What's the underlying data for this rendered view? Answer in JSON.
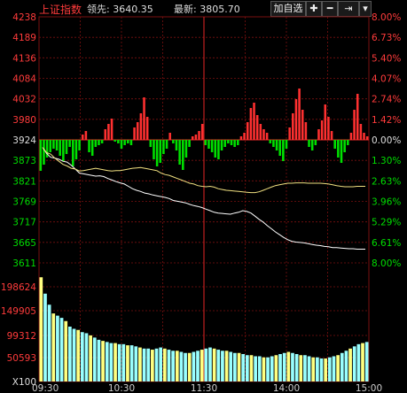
{
  "header": {
    "index_name": "上证指数",
    "lead_label": "领先:",
    "lead_value": "3640.35",
    "last_label": "最新:",
    "last_value": "3805.70",
    "add_button": "加自选",
    "plus_icon": "plus-icon",
    "minus_icon": "minus-icon",
    "skip_icon": "skip-end-icon",
    "dropdown_icon": "triangle-down-icon"
  },
  "colors": {
    "background": "#000000",
    "grid": "#7a1010",
    "up": "#ff3030",
    "down": "#00e000",
    "price_line": "#ffffff",
    "lead_line": "#f0e080",
    "volume": "#9ff"
  },
  "chart_data": {
    "type": "line",
    "left_price_ticks": [
      "4238",
      "4189",
      "4136",
      "4084",
      "4032",
      "3980",
      "3924",
      "3873",
      "3821",
      "3769",
      "3717",
      "3665",
      "3611"
    ],
    "right_pct_ticks": [
      "8.00%",
      "6.73%",
      "5.40%",
      "4.07%",
      "2.74%",
      "1.42%",
      "0.00%",
      "1.30%",
      "2.63%",
      "3.96%",
      "5.29%",
      "6.61%",
      "8.00%"
    ],
    "volume_ticks": [
      "198624",
      "149905",
      "99312",
      "50593",
      "X100"
    ],
    "time_ticks": [
      "09:30",
      "10:30",
      "11:30",
      "14:00",
      "15:00"
    ],
    "prev_close": 3924,
    "ylim": [
      3611,
      4238
    ],
    "series": [
      {
        "name": "最新",
        "values": [
          3905,
          3890,
          3880,
          3878,
          3875,
          3870,
          3868,
          3860,
          3850,
          3840,
          3838,
          3836,
          3834,
          3832,
          3833,
          3831,
          3826,
          3822,
          3818,
          3815,
          3812,
          3806,
          3800,
          3796,
          3793,
          3789,
          3787,
          3784,
          3782,
          3780,
          3778,
          3775,
          3770,
          3768,
          3766,
          3764,
          3760,
          3757,
          3755,
          3752,
          3748,
          3744,
          3740,
          3738,
          3737,
          3736,
          3735,
          3738,
          3740,
          3744,
          3742,
          3738,
          3730,
          3722,
          3715,
          3706,
          3698,
          3690,
          3683,
          3676,
          3670,
          3666,
          3664,
          3663,
          3662,
          3660,
          3658,
          3656,
          3655,
          3653,
          3652,
          3650,
          3650,
          3649,
          3648,
          3647,
          3647,
          3646,
          3646,
          3646
        ]
      },
      {
        "name": "领先",
        "values": [
          3905,
          3892,
          3888,
          3878,
          3870,
          3862,
          3858,
          3852,
          3850,
          3845,
          3846,
          3848,
          3850,
          3852,
          3850,
          3848,
          3846,
          3845,
          3846,
          3846,
          3848,
          3850,
          3852,
          3853,
          3854,
          3852,
          3850,
          3848,
          3846,
          3840,
          3836,
          3834,
          3830,
          3826,
          3822,
          3818,
          3814,
          3812,
          3808,
          3806,
          3805,
          3806,
          3804,
          3800,
          3798,
          3796,
          3795,
          3794,
          3793,
          3792,
          3791,
          3790,
          3790,
          3792,
          3796,
          3800,
          3804,
          3808,
          3810,
          3812,
          3814,
          3814,
          3815,
          3815,
          3815,
          3814,
          3814,
          3814,
          3814,
          3813,
          3812,
          3810,
          3808,
          3806,
          3805,
          3805,
          3805,
          3806,
          3806,
          3806
        ]
      }
    ],
    "bars": [
      2,
      4,
      6,
      8,
      10,
      12,
      14,
      16,
      18,
      20,
      22,
      24,
      26,
      28,
      30,
      32,
      34,
      36,
      38,
      40,
      42,
      44,
      46,
      48,
      50,
      52,
      54,
      56,
      58,
      60,
      62,
      64,
      66,
      68,
      70,
      72,
      74,
      76,
      78,
      80,
      82,
      84,
      86,
      88,
      90,
      92,
      94,
      96,
      98,
      100
    ],
    "bar_values": [
      -35,
      -28,
      -20,
      -14,
      -10,
      -12,
      -18,
      -24,
      -16,
      -8,
      -30,
      -22,
      -12,
      6,
      10,
      -14,
      -18,
      -8,
      -6,
      -4,
      12,
      18,
      24,
      -2,
      -4,
      -10,
      -6,
      -4,
      -6,
      14,
      20,
      30,
      48,
      26,
      -8,
      -22,
      -30,
      -26,
      -16,
      -10,
      8,
      -4,
      -12,
      -28,
      -34,
      -20,
      -8,
      4,
      6,
      10,
      18,
      -6,
      -10,
      -14,
      -20,
      -22,
      -12,
      -8,
      -4,
      -6,
      -8,
      -6,
      4,
      8,
      20,
      36,
      42,
      28,
      18,
      12,
      8,
      -4,
      -8,
      -12,
      -18,
      -24,
      -10,
      14,
      30,
      46,
      58,
      34,
      20,
      -8,
      -12,
      -6,
      12,
      22,
      40,
      26,
      10,
      -10,
      -20,
      -26,
      -14,
      -6,
      8,
      34,
      52,
      18,
      8,
      4
    ],
    "volume": [
      95,
      80,
      70,
      62,
      60,
      58,
      55,
      50,
      48,
      47,
      45,
      44,
      42,
      40,
      38,
      37,
      36,
      35,
      35,
      34,
      34,
      33,
      33,
      32,
      31,
      30,
      30,
      29,
      30,
      31,
      30,
      29,
      28,
      28,
      27,
      26,
      26,
      27,
      28,
      29,
      30,
      31,
      30,
      29,
      28,
      28,
      27,
      26,
      26,
      25,
      24,
      24,
      23,
      23,
      22,
      22,
      23,
      24,
      25,
      26,
      27,
      26,
      25,
      24,
      24,
      23,
      22,
      22,
      21,
      21,
      22,
      23,
      24,
      26,
      28,
      30,
      32,
      34,
      35,
      36
    ]
  }
}
